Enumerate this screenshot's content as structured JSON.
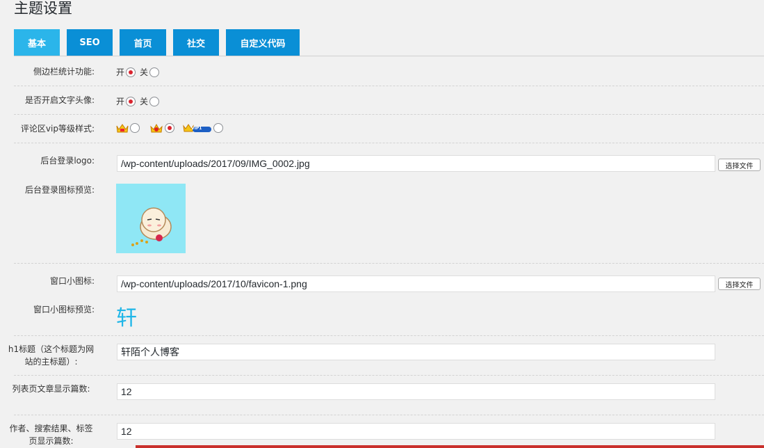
{
  "page": {
    "title": "主题设置"
  },
  "tabs": [
    {
      "label": "基本",
      "active": true
    },
    {
      "label": "SEO",
      "active": false
    },
    {
      "label": "首页",
      "active": false
    },
    {
      "label": "社交",
      "active": false
    },
    {
      "label": "自定义代码",
      "active": false
    }
  ],
  "sidebar_stats": {
    "label": "侧边栏统计功能:",
    "on_label": "开",
    "off_label": "关",
    "selected": "on"
  },
  "text_avatar": {
    "label": "是否开启文字头像:",
    "on_label": "开",
    "off_label": "关",
    "selected": "on"
  },
  "vip_style": {
    "label": "评论区vip等级样式:",
    "options": [
      "crown-small-icon",
      "crown-red-icon",
      "crown-vip1-badge-icon"
    ],
    "selected_index": 1,
    "badge_text": "VIP1"
  },
  "login_logo": {
    "label": "后台登录logo:",
    "value": "/wp-content/uploads/2017/09/IMG_0002.jpg",
    "button": "选择文件"
  },
  "login_preview": {
    "label": "后台登录图标预览:",
    "bg_color": "#8fe7f5"
  },
  "favicon": {
    "label": "窗口小图标:",
    "value": "/wp-content/uploads/2017/10/favicon-1.png",
    "button": "选择文件"
  },
  "favicon_preview": {
    "label": "窗口小图标预览:",
    "glyph": "轩"
  },
  "h1_title": {
    "label": "h1标题（这个标题为网站的主标题）:",
    "value": "轩陌个人博客"
  },
  "list_count": {
    "label": "列表页文章显示篇数:",
    "value": "12"
  },
  "archive_count": {
    "label": "作者、搜索结果、标签页显示篇数:",
    "value": "12"
  },
  "colors": {
    "tab": "#0a8fd6",
    "tab_active": "#2bb5ea",
    "radio_dot": "#d9242f",
    "favicon": "#1fb6e8"
  }
}
